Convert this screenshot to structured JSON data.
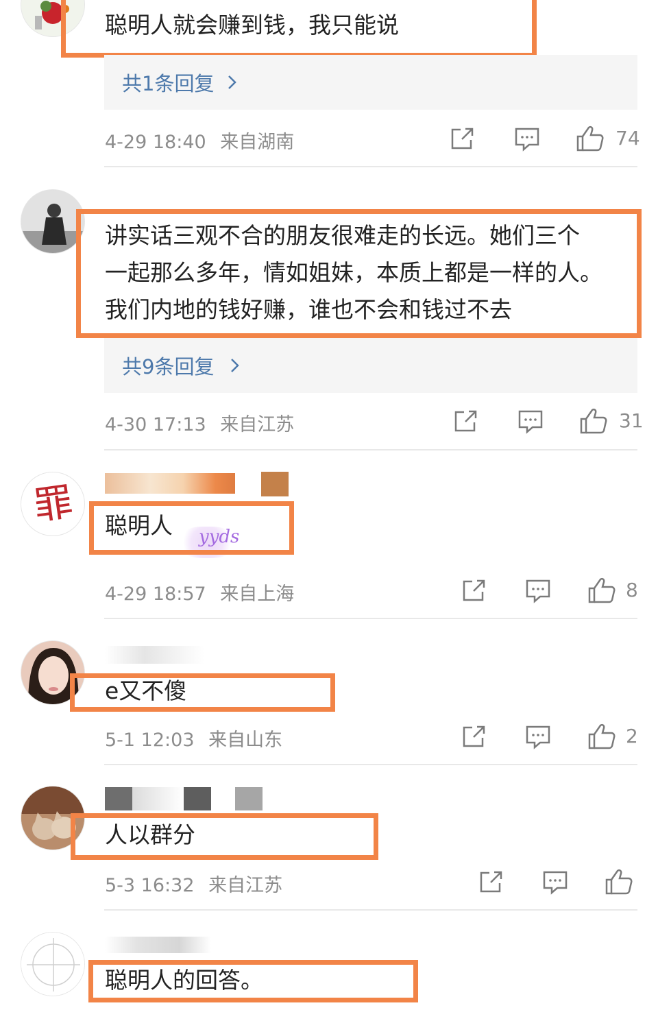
{
  "comments": [
    {
      "username": "",
      "text_lines": [
        "聪明人就会赚到钱，我只能说"
      ],
      "replies_label": "共1条回复",
      "timestamp": "4-29 18:40",
      "location": "来自湖南",
      "likes": "74"
    },
    {
      "username": "",
      "text_lines": [
        "讲实话三观不合的朋友很难走的长远。她们三个",
        "一起那么多年，情如姐妹，本质上都是一样的人。",
        "我们内地的钱好赚，谁也不会和钱过不去"
      ],
      "replies_label": "共9条回复",
      "timestamp": "4-30 17:13",
      "location": "来自江苏",
      "likes": "31"
    },
    {
      "username": "",
      "text_lines": [
        "聪明人"
      ],
      "sticker": "yyds",
      "timestamp": "4-29 18:57",
      "location": "来自上海",
      "likes": "8"
    },
    {
      "username": "",
      "text_lines": [
        "e又不傻"
      ],
      "timestamp": "5-1 12:03",
      "location": "来自山东",
      "likes": "2"
    },
    {
      "username": "",
      "text_lines": [
        "人以群分"
      ],
      "timestamp": "5-3 16:32",
      "location": "来自江苏",
      "likes": ""
    },
    {
      "username": "",
      "text_lines": [
        "聪明人的回答。"
      ]
    }
  ],
  "avatar3_glyph": "罪",
  "icons": {
    "share": "share-icon",
    "comment": "comment-icon",
    "like": "thumbs-up-icon",
    "chevron": "chevron-right-icon"
  },
  "colors": {
    "highlight": "#f28447",
    "reply_link": "#4d79ab",
    "meta": "#8c8c8c"
  }
}
